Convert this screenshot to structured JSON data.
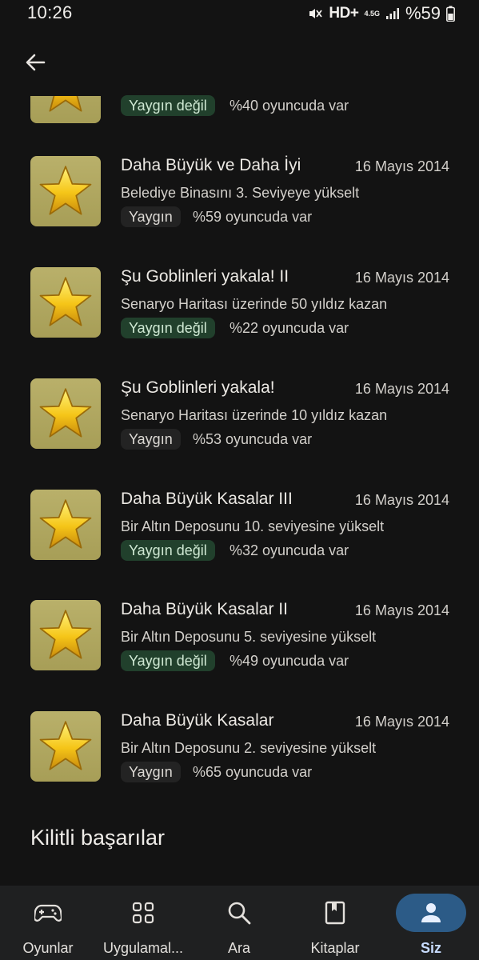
{
  "status_bar": {
    "time": "10:26",
    "network": "HD+",
    "network_type": "4.5G",
    "battery": "%59"
  },
  "achievements": [
    {
      "title": "",
      "date": "",
      "description": "",
      "rarity": "Yaygın değil",
      "percent": "%40 oyuncuda var",
      "icon": "star-icon"
    },
    {
      "title": "Daha Büyük ve Daha İyi",
      "date": "16 Mayıs 2014",
      "description": "Belediye Binasını 3. Seviyeye yükselt",
      "rarity": "Yaygın",
      "percent": "%59 oyuncuda var",
      "icon": "star-icon"
    },
    {
      "title": "Şu Goblinleri yakala! II",
      "date": "16 Mayıs 2014",
      "description": "Senaryo Haritası üzerinde 50 yıldız kazan",
      "rarity": "Yaygın değil",
      "percent": "%22 oyuncuda var",
      "icon": "star-icon"
    },
    {
      "title": "Şu Goblinleri yakala!",
      "date": "16 Mayıs 2014",
      "description": "Senaryo Haritası üzerinde 10 yıldız kazan",
      "rarity": "Yaygın",
      "percent": "%53 oyuncuda var",
      "icon": "star-icon"
    },
    {
      "title": "Daha Büyük Kasalar III",
      "date": "16 Mayıs 2014",
      "description": "Bir Altın Deposunu 10. seviyesine yükselt",
      "rarity": "Yaygın değil",
      "percent": "%32 oyuncuda var",
      "icon": "star-icon"
    },
    {
      "title": "Daha Büyük Kasalar II",
      "date": "16 Mayıs 2014",
      "description": "Bir Altın Deposunu 5. seviyesine yükselt",
      "rarity": "Yaygın değil",
      "percent": "%49 oyuncuda var",
      "icon": "star-icon"
    },
    {
      "title": "Daha Büyük Kasalar",
      "date": "16 Mayıs 2014",
      "description": "Bir Altın Deposunu 2. seviyesine yükselt",
      "rarity": "Yaygın",
      "percent": "%65 oyuncuda var",
      "icon": "star-icon"
    }
  ],
  "locked_section_title": "Kilitli başarılar",
  "bottom_nav": [
    {
      "label": "Oyunlar",
      "icon": "gamepad-icon",
      "active": false
    },
    {
      "label": "Uygulamal...",
      "icon": "apps-grid-icon",
      "active": false
    },
    {
      "label": "Ara",
      "icon": "search-icon",
      "active": false
    },
    {
      "label": "Kitaplar",
      "icon": "book-icon",
      "active": false
    },
    {
      "label": "Siz",
      "icon": "person-icon",
      "active": true
    }
  ],
  "colors": {
    "background": "#131313",
    "nav_background": "#1f2021",
    "active_pill": "#2c5b87",
    "uncommon_badge": "#21402c",
    "common_badge": "#232323",
    "achievement_icon": "#b9b06a"
  }
}
